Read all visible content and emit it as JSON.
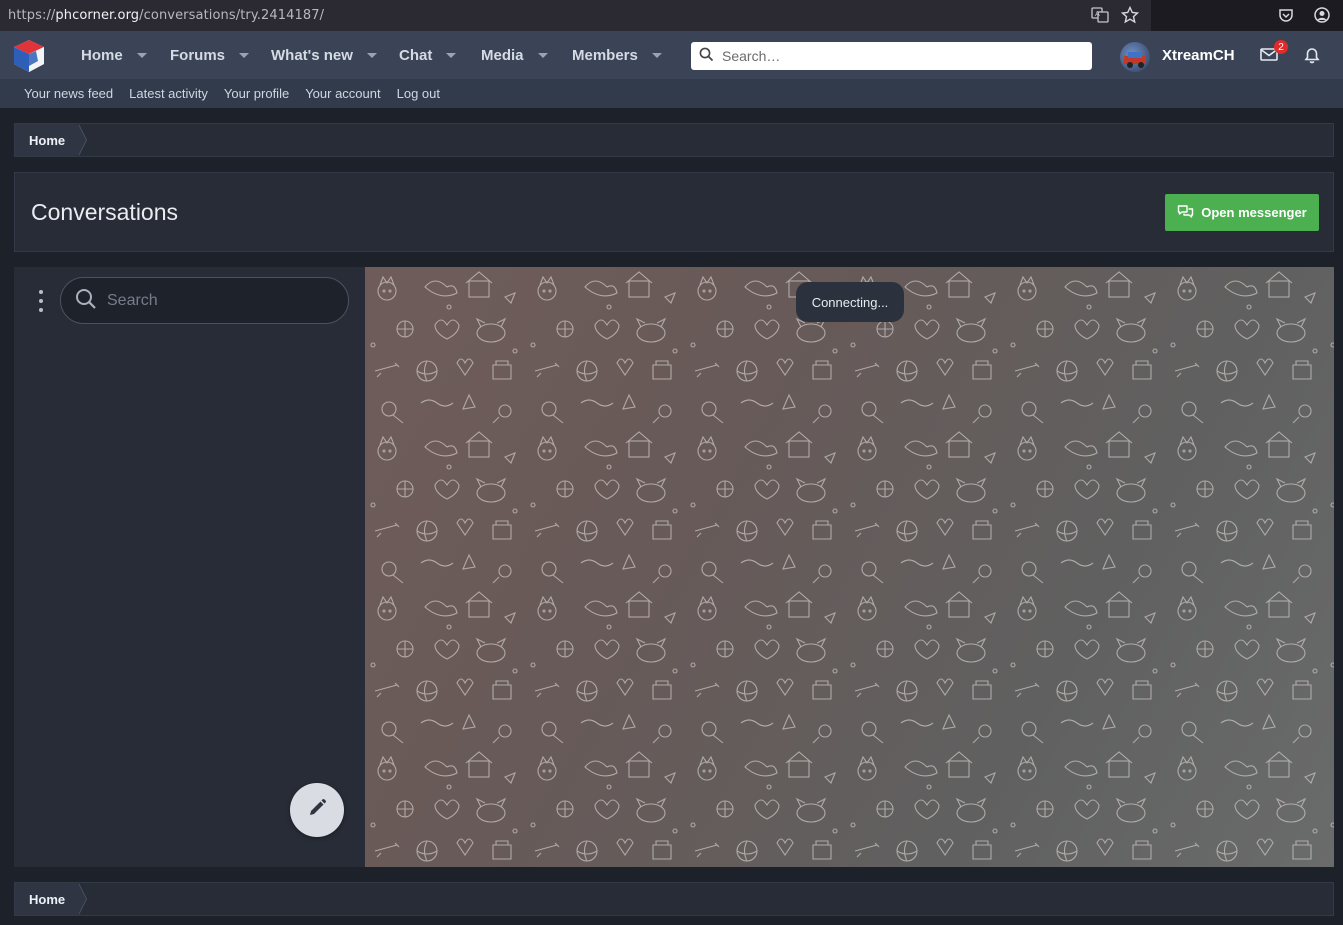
{
  "browser": {
    "url_scheme": "https://",
    "url_host": "phcorner.org",
    "url_path": "/conversations/try.2414187/"
  },
  "nav": {
    "items": [
      {
        "label": "Home"
      },
      {
        "label": "Forums"
      },
      {
        "label": "What's new"
      },
      {
        "label": "Chat"
      },
      {
        "label": "Media"
      },
      {
        "label": "Members"
      }
    ],
    "search_placeholder": "Search…",
    "username": "XtreamCH",
    "inbox_badge": "2"
  },
  "subnav": {
    "items": [
      "Your news feed",
      "Latest activity",
      "Your profile",
      "Your account",
      "Log out"
    ]
  },
  "breadcrumb": {
    "home": "Home"
  },
  "page": {
    "title": "Conversations",
    "open_messenger": "Open messenger"
  },
  "messenger": {
    "search_placeholder": "Search",
    "status": "Connecting..."
  },
  "footer_breadcrumb": {
    "home": "Home"
  },
  "colors": {
    "accent_green": "#4caf50",
    "nav_bg": "#3a4456",
    "badge_red": "#e02b2b"
  }
}
